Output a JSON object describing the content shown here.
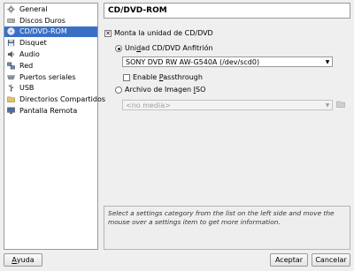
{
  "sidebar": {
    "items": [
      {
        "label": "General",
        "icon": "gear-icon"
      },
      {
        "label": "Discos Duros",
        "icon": "hard-disk-icon"
      },
      {
        "label": "CD/DVD-ROM",
        "icon": "cdrom-icon",
        "selected": true
      },
      {
        "label": "Disquet",
        "icon": "floppy-icon"
      },
      {
        "label": "Audio",
        "icon": "speaker-icon"
      },
      {
        "label": "Red",
        "icon": "network-icon"
      },
      {
        "label": "Puertos seriales",
        "icon": "serial-port-icon"
      },
      {
        "label": "USB",
        "icon": "usb-icon"
      },
      {
        "label": "Directorios Compartidos",
        "icon": "shared-folder-icon"
      },
      {
        "label": "Pantalla Remota",
        "icon": "remote-display-icon"
      }
    ]
  },
  "panel": {
    "title": "CD/DVD-ROM",
    "mount_checkbox": {
      "label": "Monta la unidad de CD/DVD",
      "checked": true
    },
    "host_drive_radio": {
      "label_pre": "Uni",
      "label_u": "d",
      "label_post": "ad CD/DVD Anfitrión",
      "checked": true
    },
    "host_drive_combo": {
      "value": "SONY DVD RW AW-G540A (/dev/scd0)"
    },
    "passthrough_checkbox": {
      "label_pre": "Enable ",
      "label_u": "P",
      "label_post": "assthrough",
      "checked": false
    },
    "iso_radio": {
      "label_pre": "Archivo de Imagen ",
      "label_u": "I",
      "label_post": "SO",
      "checked": false
    },
    "iso_combo": {
      "value": "<no media>"
    }
  },
  "info_text": "Select a settings category from the list on the left side and move the mouse over a settings item to get more information.",
  "buttons": {
    "help_u": "A",
    "help_rest": "yuda",
    "ok": "Aceptar",
    "cancel": "Cancelar"
  },
  "colors": {
    "selection": "#3a6fc6",
    "window_bg": "#efefef"
  }
}
